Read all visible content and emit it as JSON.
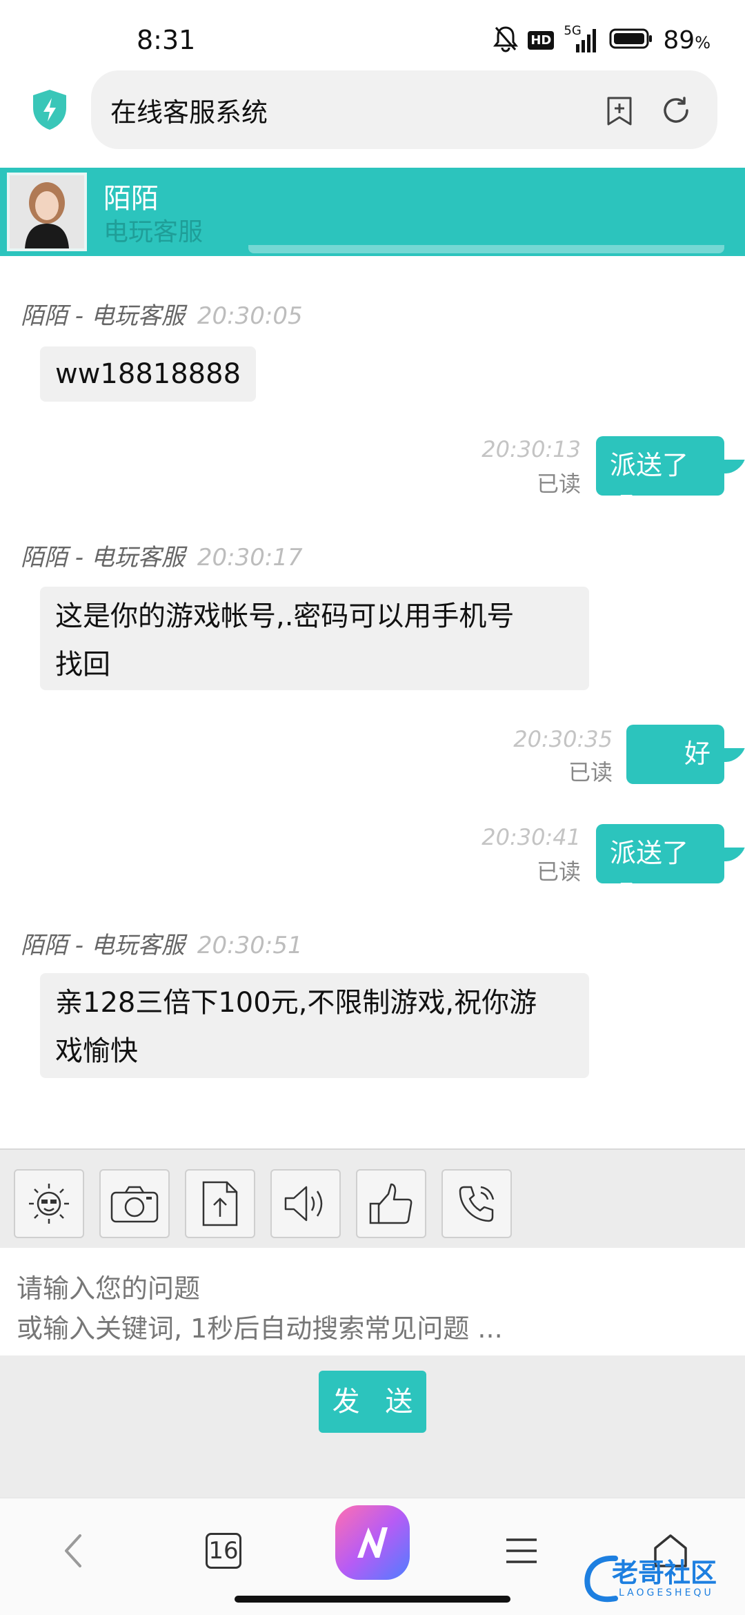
{
  "status_bar": {
    "time": "8:31",
    "network": "5G",
    "battery": "89",
    "battery_unit": "%",
    "hd_badge": "HD"
  },
  "browser": {
    "title": "在线客服系统",
    "tab_count": "16"
  },
  "chat": {
    "agent_name": "陌陌",
    "agent_role": "电玩客服",
    "messages": [
      {
        "from": "agent",
        "sender": "陌陌 - 电玩客服",
        "time": "20:30:05",
        "text": "ww18818888"
      },
      {
        "from": "user",
        "time": "20:30:13",
        "status": "已读",
        "text": "派送了吗"
      },
      {
        "from": "agent",
        "sender": "陌陌 - 电玩客服",
        "time": "20:30:17",
        "text_line1": "这是你的游戏帐号,.密码可以用手机号",
        "text_line2": "找回"
      },
      {
        "from": "user",
        "time": "20:30:35",
        "status": "已读",
        "text": "好"
      },
      {
        "from": "user",
        "time": "20:30:41",
        "status": "已读",
        "text": "派送了吗"
      },
      {
        "from": "agent",
        "sender": "陌陌 - 电玩客服",
        "time": "20:30:51",
        "text_line1": "亲128三倍下100元,不限制游戏,祝你游",
        "text_line2": "戏愉快"
      }
    ]
  },
  "toolbar": {
    "tools": [
      "emoji-icon",
      "camera-icon",
      "upload-icon",
      "voice-icon",
      "thumbs-up-icon",
      "phone-icon"
    ]
  },
  "input": {
    "placeholder_line1": "请输入您的问题",
    "placeholder_line2": "或输入关键词, 1秒后自动搜索常见问题 ..."
  },
  "send_label": "发 送",
  "watermark": {
    "text": "老哥社区",
    "sub": "LAOGESHEQU"
  },
  "colors": {
    "accent": "#2cc4bd",
    "agent_bubble": "#f0f0f0"
  }
}
